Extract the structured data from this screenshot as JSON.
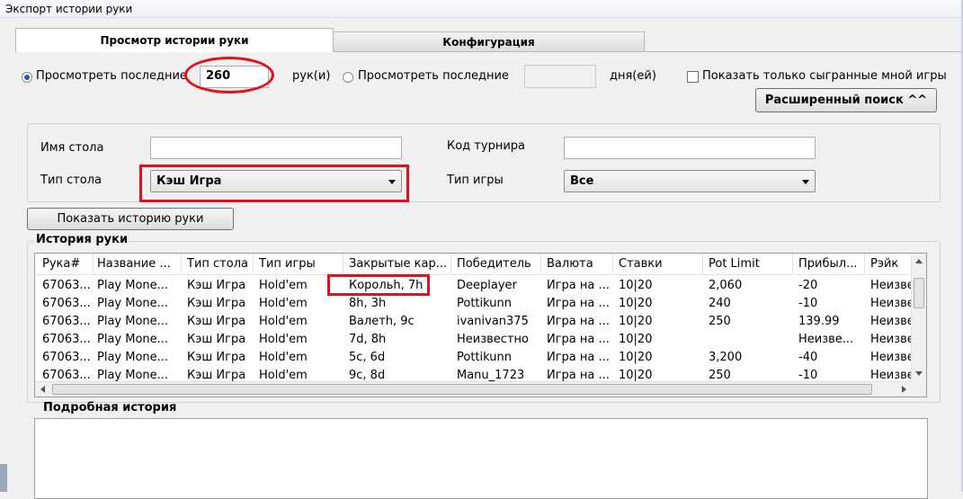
{
  "window": {
    "title": "Экспорт истории руки"
  },
  "tabs": [
    {
      "label": "Просмотр истории руки",
      "active": true
    },
    {
      "label": "Конфигурация",
      "active": false
    }
  ],
  "filters": {
    "view_last_label": "Просмотреть последние",
    "hands_count": "260",
    "hands_unit": "рук(и)",
    "view_last_days_label": "Просмотреть последние",
    "days_value": "",
    "days_unit": "дня(ей)",
    "only_my_games_label": "Показать только сыгранные мной игры",
    "advanced_search_label": "Расширенный поиск ^^"
  },
  "search": {
    "table_name_label": "Имя стола",
    "table_name_value": "",
    "tournament_code_label": "Код турнира",
    "tournament_code_value": "",
    "table_type_label": "Тип стола",
    "table_type_value": "Кэш Игра",
    "game_type_label": "Тип игры",
    "game_type_value": "Все",
    "show_history_button": "Показать историю руки"
  },
  "history": {
    "group_label": "История руки",
    "columns": [
      "Рука#",
      "Название ...",
      "Тип стола",
      "Тип игры",
      "Закрытые кар...",
      "Победитель",
      "Валюта",
      "Ставки",
      "Pot Limit",
      "Прибыл...",
      "Рэйк"
    ],
    "rows": [
      [
        "67063...",
        "Play Mone...",
        "Кэш Игра",
        "Hold'em",
        "Корольh, 7h",
        "Deeplayer",
        "Игра на ...",
        "10|20",
        "2,060",
        "-20",
        "Неизве"
      ],
      [
        "67063...",
        "Play Mone...",
        "Кэш Игра",
        "Hold'em",
        "8h, 3h",
        "Pottikunn",
        "Игра на ...",
        "10|20",
        "240",
        "-10",
        "Неизве"
      ],
      [
        "67063...",
        "Play Mone...",
        "Кэш Игра",
        "Hold'em",
        "Валетh, 9c",
        "ivanivan375",
        "Игра на ...",
        "10|20",
        "250",
        "139.99",
        "Неизве"
      ],
      [
        "67063...",
        "Play Mone...",
        "Кэш Игра",
        "Hold'em",
        "7d, 8h",
        "Неизвестно",
        "Игра на ...",
        "10|20",
        "",
        "Неизве...",
        "Неизве"
      ],
      [
        "67063...",
        "Play Mone...",
        "Кэш Игра",
        "Hold'em",
        "5c, 6d",
        "Pottikunn",
        "Игра на ...",
        "10|20",
        "3,200",
        "-40",
        "Неизве"
      ],
      [
        "67063...",
        "Play Mone...",
        "Кэш Игра",
        "Hold'em",
        "9c, 8d",
        "Manu_1723",
        "Игра на ...",
        "10|20",
        "250",
        "-10",
        "Неизве"
      ]
    ]
  },
  "detail": {
    "label": "Подробная история",
    "content": ""
  },
  "colors": {
    "highlight": "#e0101c",
    "radio_dot": "#2a5db0"
  },
  "icons": [
    "radio-icon",
    "checkbox-icon",
    "dropdown-arrow-icon",
    "scroll-up-icon",
    "scroll-down-icon",
    "scroll-left-icon",
    "scroll-right-icon"
  ]
}
